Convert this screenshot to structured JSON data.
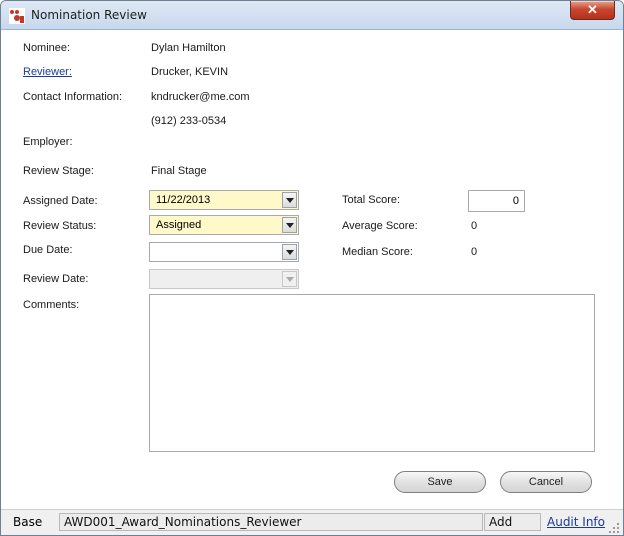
{
  "window": {
    "title": "Nomination Review",
    "close_glyph": "✕"
  },
  "fields": {
    "nominee": {
      "label": "Nominee:",
      "value": "Dylan Hamilton"
    },
    "reviewer": {
      "label": "Reviewer:",
      "value": "Drucker, KEVIN"
    },
    "contact": {
      "label": "Contact Information:",
      "email": "kndrucker@me.com",
      "phone": "(912) 233-0534"
    },
    "employer": {
      "label": "Employer:",
      "value": ""
    },
    "review_stage": {
      "label": "Review Stage:",
      "value": "Final Stage"
    },
    "assigned_date": {
      "label": "Assigned Date:",
      "value": "11/22/2013"
    },
    "review_status": {
      "label": "Review Status:",
      "value": "Assigned"
    },
    "due_date": {
      "label": "Due Date:",
      "value": ""
    },
    "review_date": {
      "label": "Review Date:",
      "value": ""
    },
    "comments": {
      "label": "Comments:",
      "value": ""
    }
  },
  "scores": {
    "total": {
      "label": "Total Score:",
      "value": "0"
    },
    "average": {
      "label": "Average Score:",
      "value": "0"
    },
    "median": {
      "label": "Median Score:",
      "value": "0"
    }
  },
  "buttons": {
    "save": "Save",
    "cancel": "Cancel"
  },
  "statusbar": {
    "base": "Base",
    "form_name": "AWD001_Award_Nominations_Reviewer",
    "mode": "Add",
    "audit_link": "Audit Info"
  },
  "colors": {
    "required_field_bg": "#fff8c8",
    "link": "#1a3b9c"
  }
}
